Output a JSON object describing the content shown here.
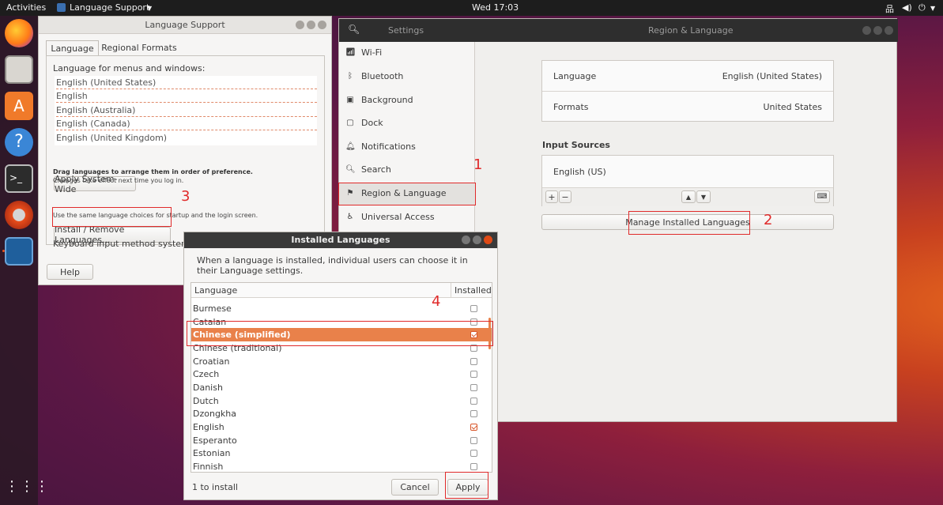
{
  "topbar": {
    "activities": "Activities",
    "app_menu": "Language Support",
    "clock": "Wed 17:03"
  },
  "dock": {
    "items": [
      "firefox-icon",
      "files-icon",
      "software-icon",
      "help-icon",
      "terminal-icon",
      "settings-icon",
      "language-icon",
      "apps-grid-icon"
    ]
  },
  "lang_support": {
    "title": "Language Support",
    "tabs": [
      "Language",
      "Regional Formats"
    ],
    "menus_label": "Language for menus and windows:",
    "languages": [
      "English (United States)",
      "English",
      "English (Australia)",
      "English (Canada)",
      "English (United Kingdom)"
    ],
    "apply_system_wide": "Apply System-Wide",
    "drag_note": "Drag languages to arrange them in order of preference.",
    "changes_note": "Changes take effect next time you log in.",
    "same_note": "Use the same language choices for startup and the login screen.",
    "install_remove": "Install / Remove Languages...",
    "keyboard_label": "Keyboard input method system:",
    "help": "Help"
  },
  "settings": {
    "sidebar_title": "Settings",
    "title": "Region & Language",
    "sidebar": [
      "Wi-Fi",
      "Bluetooth",
      "Background",
      "Dock",
      "Notifications",
      "Search",
      "Region & Language",
      "Universal Access"
    ],
    "language_label": "Language",
    "language_value": "English (United States)",
    "formats_label": "Formats",
    "formats_value": "United States",
    "input_sources_label": "Input Sources",
    "input_source": "English (US)",
    "manage_button": "Manage Installed Languages"
  },
  "installed": {
    "title": "Installed Languages",
    "description": "When a language is installed, individual users can choose it in their Language settings.",
    "col_language": "Language",
    "col_installed": "Installed",
    "rows": [
      {
        "name": "Burmese",
        "installed": false
      },
      {
        "name": "Catalan",
        "installed": false
      },
      {
        "name": "Chinese (simplified)",
        "installed": true
      },
      {
        "name": "Chinese (traditional)",
        "installed": false
      },
      {
        "name": "Croatian",
        "installed": false
      },
      {
        "name": "Czech",
        "installed": false
      },
      {
        "name": "Danish",
        "installed": false
      },
      {
        "name": "Dutch",
        "installed": false
      },
      {
        "name": "Dzongkha",
        "installed": false
      },
      {
        "name": "English",
        "installed": true
      },
      {
        "name": "Esperanto",
        "installed": false
      },
      {
        "name": "Estonian",
        "installed": false
      },
      {
        "name": "Finnish",
        "installed": false
      }
    ],
    "status": "1 to install",
    "cancel": "Cancel",
    "apply": "Apply"
  },
  "annotations": [
    "1",
    "2",
    "3",
    "4"
  ]
}
